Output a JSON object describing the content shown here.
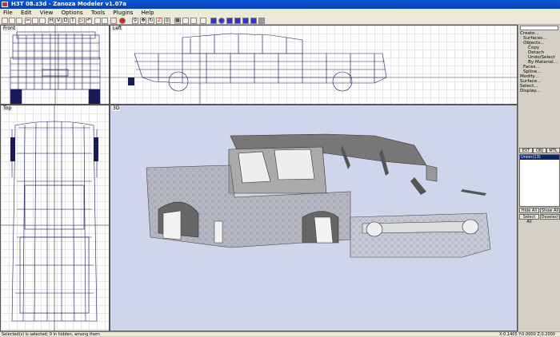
{
  "window": {
    "title": "H3T 08.z3d - Zanoza Modeler v1.07a"
  },
  "menu": [
    "File",
    "Edit",
    "View",
    "Options",
    "Tools",
    "Plugins",
    "Help"
  ],
  "toolbar_icons": [
    "new-icon",
    "open-icon",
    "save-icon",
    "cut-icon",
    "copy-icon",
    "paste-icon",
    "h-icon",
    "v-icon",
    "d-icon",
    "t-icon",
    "mirror-icon",
    "undo-icon",
    "snap-icon",
    "grid-icon",
    "zoom-icon",
    "box-icon",
    "sphere-icon",
    "cylinder-icon",
    "cone-icon",
    "torus-icon",
    "light-icon",
    "camera-icon",
    "render-icon"
  ],
  "toolbar_letters": {
    "h": "H",
    "v": "V",
    "d": "D",
    "t": "T",
    "z": "Z"
  },
  "viewports": {
    "front": "Front",
    "left": "Left",
    "top": "Top",
    "persp": "3D"
  },
  "panel": {
    "tree": [
      "Create...",
      "Surfaces...",
      "Objects...",
      "Copy",
      "Detach",
      "Undo/Select",
      "By Material...",
      "Faces...",
      "Spline...",
      "Modify...",
      "Surface...",
      "Select...",
      "Display..."
    ],
    "tabs": [
      "EXT",
      "OBJ",
      "MTL"
    ],
    "list_item": "Union(13)",
    "hide_all": "Hide All",
    "show_all": "Show All",
    "select_all": "Select All",
    "deselect": "Deselect"
  },
  "status": {
    "left": "Selected(s) is selected; 0 in hidden, among them",
    "coords": "X:0.1405  Y:0.0000  Z:0.2000"
  }
}
